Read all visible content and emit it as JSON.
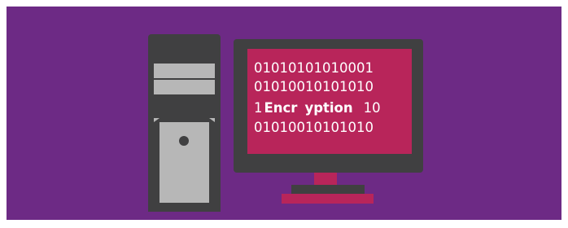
{
  "colors": {
    "background": "#6d2a85",
    "device_body": "#404041",
    "drive_gray": "#b7b7b7",
    "screen": "#b8255a",
    "text": "#ffffff"
  },
  "screen": {
    "line1": "01010101010001",
    "line2": "01010010101010",
    "line3_prefix": "1",
    "line3_word_a": "Encr",
    "line3_word_b": "yption",
    "line3_suffix": "10",
    "line4": "01010010101010"
  },
  "icons": [
    "computer-tower-icon",
    "monitor-icon",
    "power-button-icon"
  ]
}
